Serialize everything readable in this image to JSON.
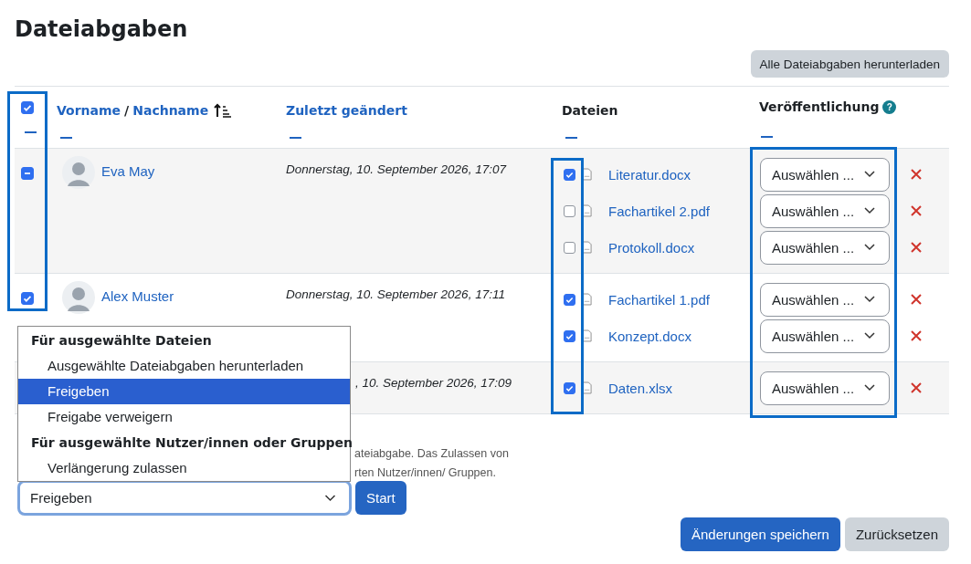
{
  "title": "Dateiabgaben",
  "download_all_button": "Alle Dateiabgaben herunterladen",
  "table": {
    "select_all": {
      "checked": true
    },
    "header": {
      "first_name": "Vorname",
      "separator": "/",
      "last_name": "Nachname",
      "modified": "Zuletzt geändert",
      "files": "Dateien",
      "publication": "Veröffentlichung",
      "help": "?"
    },
    "rows": [
      {
        "name": "Eva May",
        "kind": "indeterminate",
        "modified": "Donnerstag, 10. September 2026, 17:07",
        "files": [
          {
            "name": "Literatur.docx",
            "checked": true,
            "publication": "Auswählen ..."
          },
          {
            "name": "Fachartikel 2.pdf",
            "checked": false,
            "publication": "Auswählen ..."
          },
          {
            "name": "Protokoll.docx",
            "checked": false,
            "publication": "Auswählen ..."
          }
        ]
      },
      {
        "name": "Alex Muster",
        "kind": "checked",
        "modified": "Donnerstag, 10. September 2026, 17:11",
        "files": [
          {
            "name": "Fachartikel 1.pdf",
            "checked": true,
            "publication": "Auswählen ..."
          },
          {
            "name": "Konzept.docx",
            "checked": true,
            "publication": "Auswählen ..."
          }
        ]
      },
      {
        "modified": ", 10. September 2026, 17:09",
        "files": [
          {
            "name": "Daten.xlsx",
            "checked": true,
            "publication": "Auswählen ..."
          }
        ]
      }
    ]
  },
  "note_lines": [
    "ateiabgabe. Das Zulassen von",
    "rten Nutzer/innen/ Gruppen."
  ],
  "action_menu": {
    "groups": [
      {
        "label": "Für ausgewählte Dateien",
        "options": [
          {
            "label": "Ausgewählte Dateiabgaben herunterladen",
            "selected": false
          },
          {
            "label": "Freigeben",
            "selected": true
          },
          {
            "label": "Freigabe verweigern",
            "selected": false
          }
        ]
      },
      {
        "label": "Für ausgewählte Nutzer/innen oder Gruppen",
        "options": [
          {
            "label": "Verlängerung zulassen",
            "selected": false
          }
        ]
      }
    ]
  },
  "action_select": {
    "value": "Freigeben"
  },
  "start_button": "Start",
  "save_button": "Änderungen speichern",
  "reset_button": "Zurücksetzen"
}
